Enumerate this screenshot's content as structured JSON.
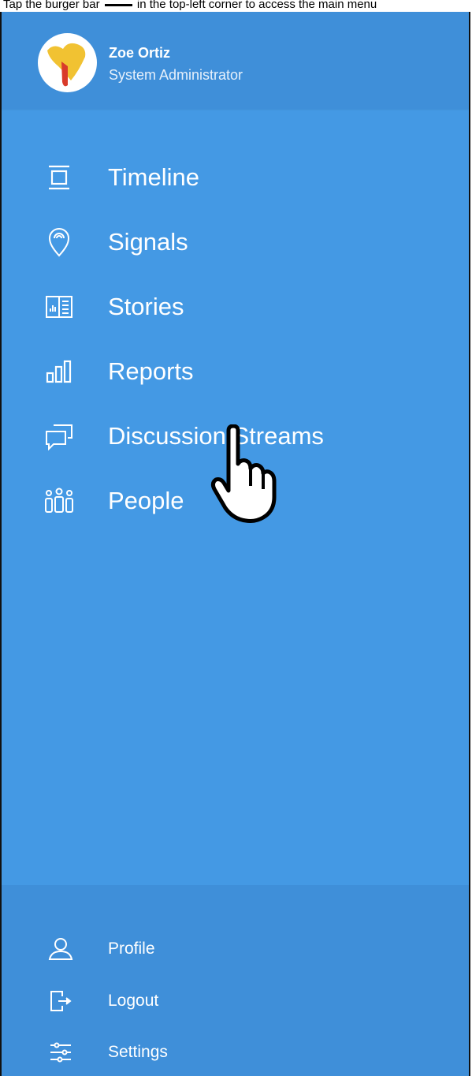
{
  "instruction": {
    "before": "Tap the burger bar",
    "after": "in the top-left corner to access the main menu"
  },
  "user": {
    "name": "Zoe Ortiz",
    "role": "System Administrator"
  },
  "nav": {
    "items": [
      {
        "label": "Timeline",
        "icon": "timeline-icon"
      },
      {
        "label": "Signals",
        "icon": "location-pin-icon"
      },
      {
        "label": "Stories",
        "icon": "stories-book-icon"
      },
      {
        "label": "Reports",
        "icon": "bar-chart-icon"
      },
      {
        "label": "Discussion Streams",
        "icon": "chat-bubbles-icon"
      },
      {
        "label": "People",
        "icon": "people-icon"
      }
    ]
  },
  "footer": {
    "items": [
      {
        "label": "Profile",
        "icon": "user-icon"
      },
      {
        "label": "Logout",
        "icon": "logout-icon"
      },
      {
        "label": "Settings",
        "icon": "sliders-icon"
      }
    ]
  },
  "colors": {
    "drawer_bg": "#4499e4",
    "header_bg": "#3f8fd9",
    "text": "#ffffff"
  },
  "cursor": {
    "icon": "hand-pointer-icon"
  }
}
